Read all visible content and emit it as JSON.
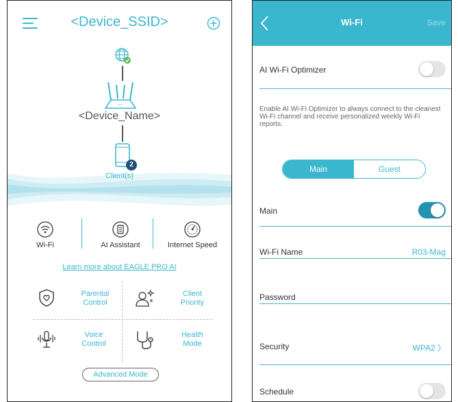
{
  "left_screen": {
    "header": {
      "title": "<Device_SSID>",
      "menu_icon": "hamburger-icon",
      "add_icon": "plus-circle-icon"
    },
    "topology": {
      "device_name": "<Device_Name>",
      "client_count": "2",
      "clients_label": "Client(s)"
    },
    "features": [
      {
        "label": "Wi-Fi",
        "icon": "wifi-icon"
      },
      {
        "label": "AI Assistant",
        "icon": "ai-assistant-icon"
      },
      {
        "label": "Internet Speed",
        "icon": "speedometer-icon"
      }
    ],
    "learn_more": "Learn more about EAGLE PRO AI",
    "grid": [
      {
        "line1": "Parental",
        "line2": "Control",
        "icon": "shield-heart-icon"
      },
      {
        "line1": "Client",
        "line2": "Priority",
        "icon": "user-sparkle-icon"
      },
      {
        "line1": "Voice",
        "line2": "Control",
        "icon": "microphone-icon"
      },
      {
        "line1": "Health",
        "line2": "Mode",
        "icon": "stethoscope-icon"
      }
    ],
    "advanced_mode": "Advanced Mode"
  },
  "right_screen": {
    "header": {
      "title": "Wi-Fi",
      "save": "Save",
      "back_icon": "chevron-left-icon"
    },
    "ai_optimizer": {
      "label": "AI Wi-Fi Optimizer",
      "enabled": false
    },
    "description": "Enable AI Wi-Fi Optimizer to always connect to the cleanest Wi-Fi channel and receive personalized weekly Wi-Fi reports.",
    "tabs": [
      {
        "label": "Main",
        "active": true
      },
      {
        "label": "Guest",
        "active": false
      }
    ],
    "main_toggle": {
      "label": "Main",
      "enabled": true
    },
    "wifi_name": {
      "label": "Wi-Fi Name",
      "value": "R03-Mag"
    },
    "password": {
      "label": "Password",
      "value": ""
    },
    "security": {
      "label": "Security",
      "value": "WPA2 〉"
    },
    "schedule": {
      "label": "Schedule",
      "enabled": false
    }
  },
  "colors": {
    "accent": "#3bb6cf",
    "toggle_on": "#2393b0",
    "badge": "#1f4e79"
  }
}
